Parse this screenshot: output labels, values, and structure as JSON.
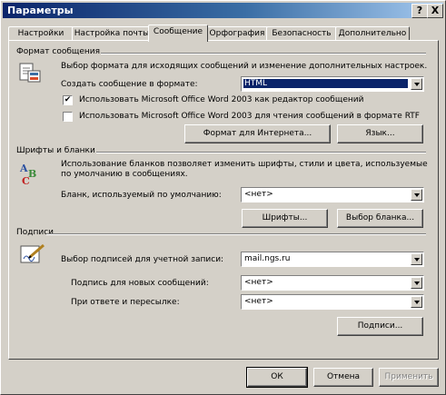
{
  "window": {
    "title": "Параметры",
    "help_btn": "?",
    "close_btn": "X"
  },
  "tabs": [
    "Настройки",
    "Настройка почты",
    "Сообщение",
    "Орфография",
    "Безопасность",
    "Дополнительно"
  ],
  "format": {
    "group_title": "Формат сообщения",
    "description": "Выбор формата для исходящих сообщений и изменение дополнительных настроек.",
    "compose_label": "Создать сообщение в формате:",
    "compose_value": "HTML",
    "use_word_editor_label": "Использовать Microsoft Office Word 2003 как редактор сообщений",
    "use_word_editor_checked": "✔",
    "use_word_reader_label": "Использовать Microsoft Office Word 2003 для чтения сообщений в формате RTF",
    "internet_format_btn": "Формат для Интернета...",
    "language_btn": "Язык..."
  },
  "fonts": {
    "group_title": "Шрифты и бланки",
    "description_line1": "Использование бланков позволяет изменить шрифты, стили и цвета, используемые",
    "description_line2": "по умолчанию в сообщениях.",
    "default_stationery_label": "Бланк, используемый по умолчанию:",
    "default_stationery_value": "<нет>",
    "fonts_btn": "Шрифты...",
    "stationery_picker_btn": "Выбор бланка..."
  },
  "signatures": {
    "group_title": "Подписи",
    "account_label": "Выбор подписей для учетной записи:",
    "account_value": "mail.ngs.ru",
    "new_messages_label": "Подпись для новых сообщений:",
    "new_messages_value": "<нет>",
    "replies_label": "При ответе и пересылке:",
    "replies_value": "<нет>",
    "signatures_btn": "Подписи..."
  },
  "footer": {
    "ok": "ОК",
    "cancel": "Отмена",
    "apply": "Применить"
  }
}
